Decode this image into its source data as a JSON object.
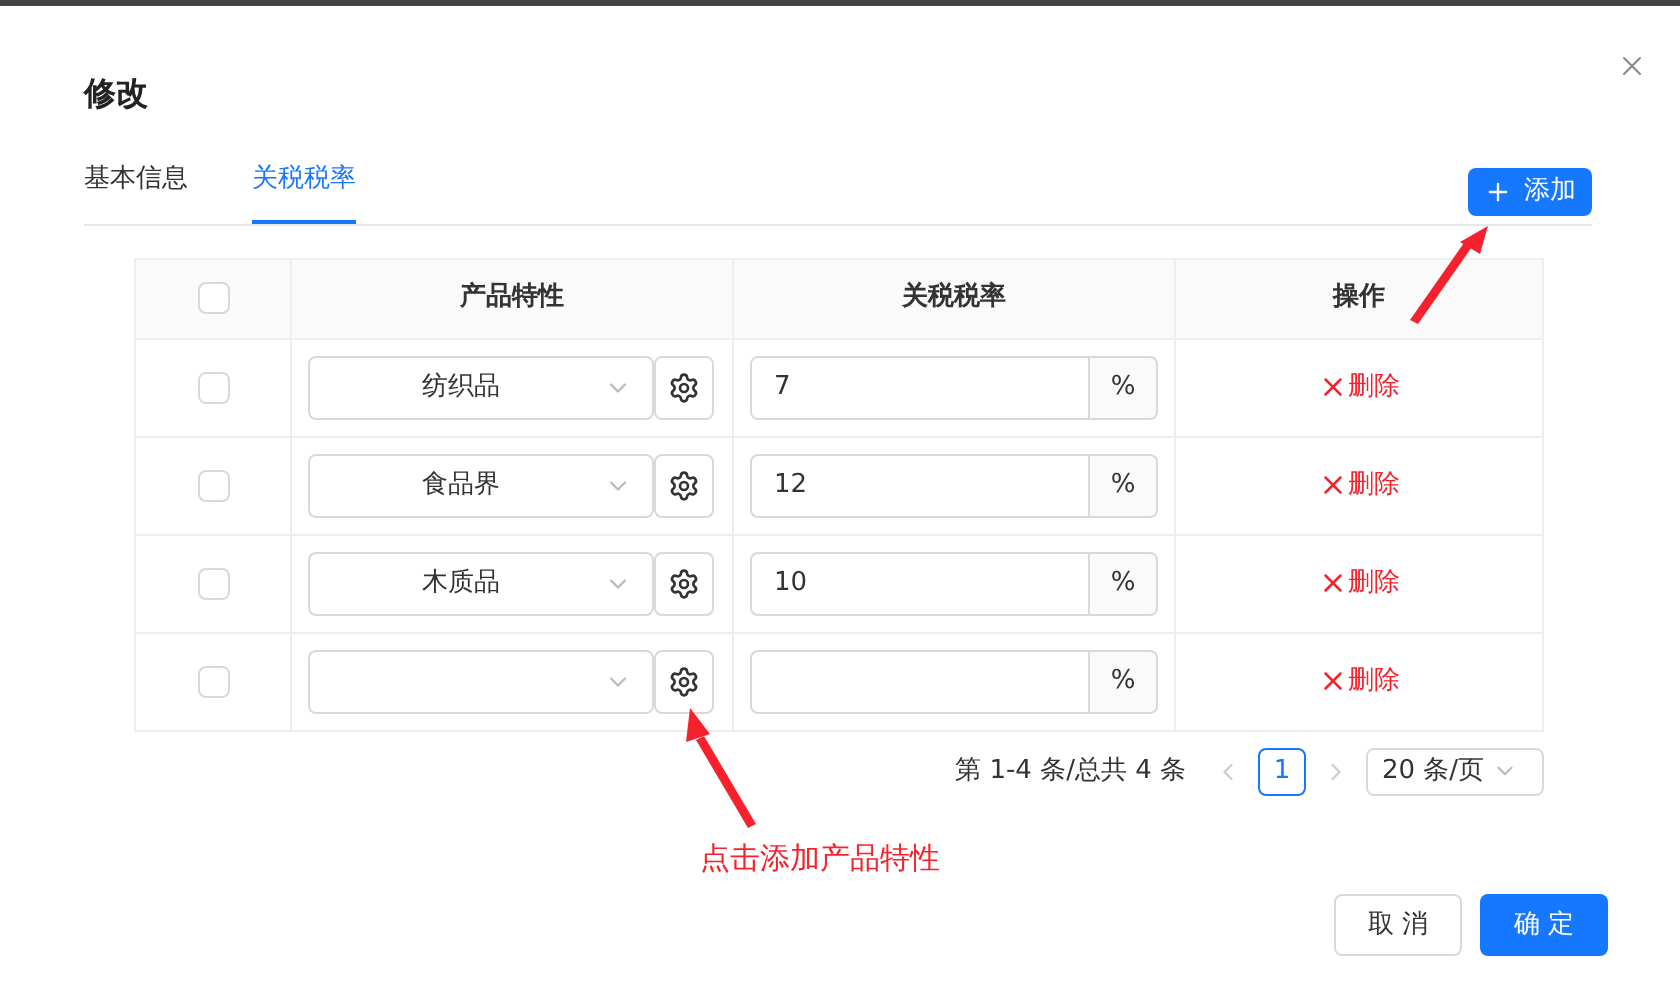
{
  "dialog": {
    "title": "修改"
  },
  "tabs": [
    {
      "label": "基本信息",
      "selected": false
    },
    {
      "label": "关税税率",
      "selected": true
    }
  ],
  "add_button": {
    "label": "添加"
  },
  "table": {
    "header_checked": false,
    "columns": [
      "产品特性",
      "关税税率",
      "操作"
    ],
    "rows": [
      {
        "checked": false,
        "product": "纺织品",
        "rate": "7",
        "unit": "%",
        "action": "删除"
      },
      {
        "checked": false,
        "product": "食品界",
        "rate": "12",
        "unit": "%",
        "action": "删除"
      },
      {
        "checked": false,
        "product": "木质品",
        "rate": "10",
        "unit": "%",
        "action": "删除"
      },
      {
        "checked": false,
        "unit": "%",
        "action": "删除"
      }
    ]
  },
  "pagination": {
    "summary": "第 1-4 条/总共 4 条",
    "pages": [
      {
        "label": "1",
        "selected": true
      }
    ],
    "page_size": "20 条/页"
  },
  "annotations": [
    {
      "text": "点击添加产品特性"
    }
  ],
  "footer_buttons": [
    {
      "label": "取 消",
      "kind": "secondary"
    },
    {
      "label": "确 定",
      "kind": "primary"
    }
  ]
}
